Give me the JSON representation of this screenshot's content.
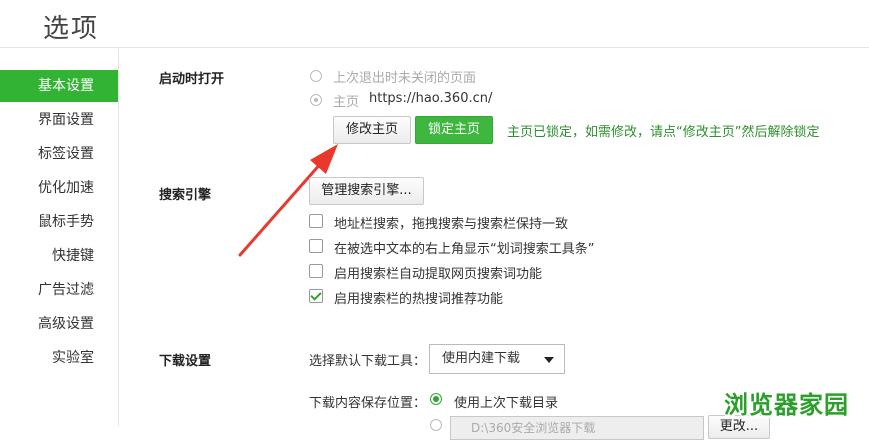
{
  "window": {
    "title": "选项"
  },
  "sidebar": {
    "items": [
      {
        "label": "基本设置",
        "active": true
      },
      {
        "label": "界面设置"
      },
      {
        "label": "标签设置"
      },
      {
        "label": "优化加速"
      },
      {
        "label": "鼠标手势"
      },
      {
        "label": "快捷键"
      },
      {
        "label": "广告过滤"
      },
      {
        "label": "高级设置"
      },
      {
        "label": "实验室"
      }
    ]
  },
  "startup": {
    "title": "启动时打开",
    "option_restore": "上次退出时未关闭的页面",
    "option_home_label": "主页",
    "home_url": "https://hao.360.cn/",
    "modify_button": "修改主页",
    "lock_button": "锁定主页",
    "lock_note": "主页已锁定，如需修改，请点“修改主页”然后解除锁定"
  },
  "search": {
    "title": "搜索引擎",
    "manage_button": "管理搜索引擎...",
    "options": [
      {
        "label": "地址栏搜索，拖拽搜索与搜索栏保持一致",
        "checked": false
      },
      {
        "label": "在被选中文本的右上角显示“划词搜索工具条”",
        "checked": false
      },
      {
        "label": "启用搜索栏自动提取网页搜索词功能",
        "checked": false
      },
      {
        "label": "启用搜索栏的热搜词推荐功能",
        "checked": true
      }
    ]
  },
  "download": {
    "title": "下载设置",
    "tool_label": "选择默认下载工具：",
    "tool_value": "使用内建下载",
    "location_label": "下载内容保存位置：",
    "location_option": "使用上次下载目录",
    "path_value": "D:\\360安全浏览器下载",
    "change_button": "更改..."
  },
  "watermark": {
    "text": "浏览器家园"
  },
  "colors": {
    "accent": "#33b334",
    "arrow": "#e8392c",
    "note": "#2d8f2d"
  }
}
